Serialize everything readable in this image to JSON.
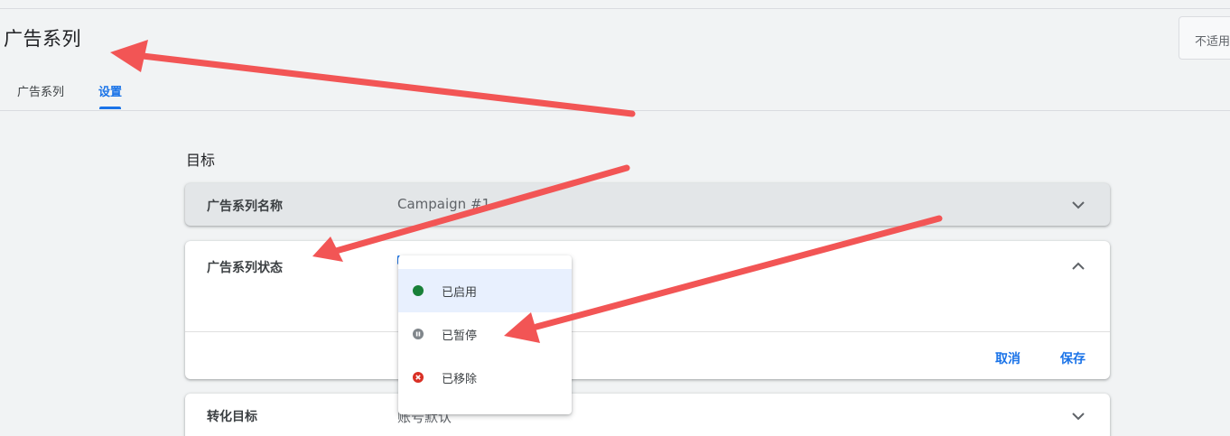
{
  "header": {
    "title": "广告系列",
    "filter_text": "不适用"
  },
  "tabs": [
    {
      "label": "广告系列",
      "active": false
    },
    {
      "label": "设置",
      "active": true
    }
  ],
  "section": {
    "heading": "目标"
  },
  "cards": {
    "campaign_name": {
      "label": "广告系列名称",
      "value": "Campaign #1"
    },
    "campaign_status": {
      "label": "广告系列状态",
      "cancel_label": "取消",
      "save_label": "保存"
    },
    "conversion_goal": {
      "label": "转化目标",
      "value": "账号默认"
    }
  },
  "status_menu": {
    "options": [
      {
        "label": "已启用",
        "icon": "enabled-dot-icon",
        "color": "#188038",
        "selected": true
      },
      {
        "label": "已暂停",
        "icon": "paused-icon",
        "color": "#80868b",
        "selected": false
      },
      {
        "label": "已移除",
        "icon": "removed-icon",
        "color": "#d93025",
        "selected": false
      }
    ]
  },
  "colors": {
    "accent": "#1a73e8",
    "annotation_arrow": "#f25555"
  }
}
